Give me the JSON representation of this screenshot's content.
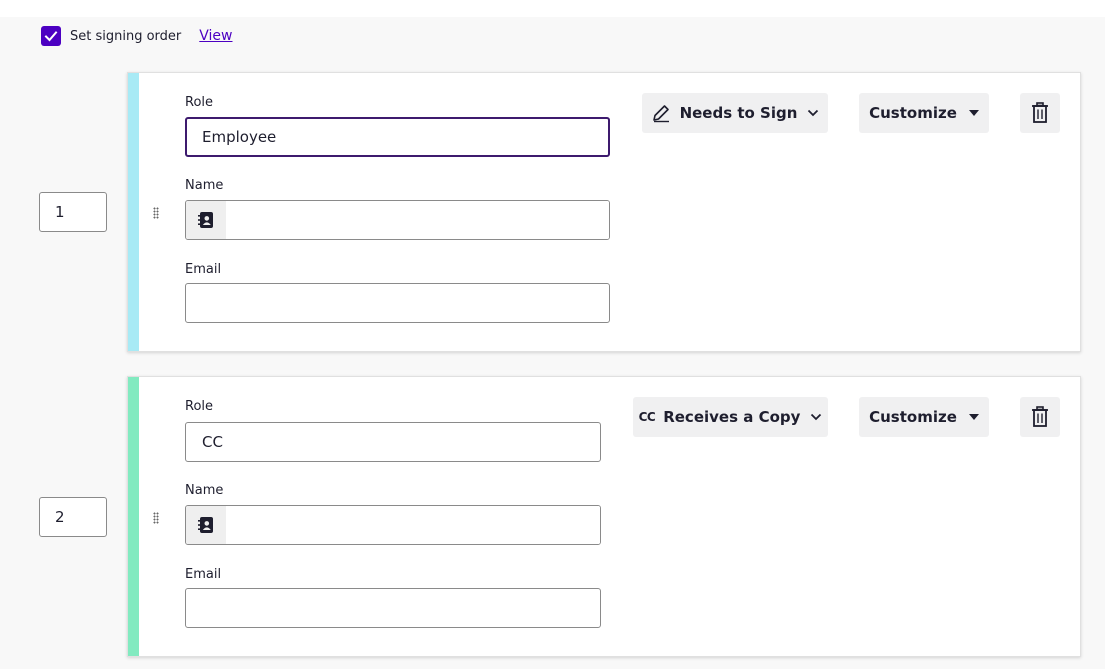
{
  "signing_order": {
    "checked": true,
    "label": "Set signing order",
    "view_link": "View"
  },
  "recipients": [
    {
      "order": "1",
      "accent_color": "#a8eaf5",
      "role_label": "Role",
      "role_value": "Employee",
      "name_label": "Name",
      "name_value": "",
      "email_label": "Email",
      "email_value": "",
      "action_label": "Needs to Sign",
      "action_icon": "pen-icon",
      "customize_label": "Customize",
      "delete_icon": "trash-icon"
    },
    {
      "order": "2",
      "accent_color": "#82eac0",
      "role_label": "Role",
      "role_value": "CC",
      "name_label": "Name",
      "name_value": "",
      "email_label": "Email",
      "email_value": "",
      "action_label": "Receives a Copy",
      "action_icon_text": "CC",
      "customize_label": "Customize",
      "delete_icon": "trash-icon"
    }
  ],
  "colors": {
    "brand": "#4c00c2",
    "focus_border": "#3d1a6e",
    "button_bg": "#f0f0f1"
  }
}
